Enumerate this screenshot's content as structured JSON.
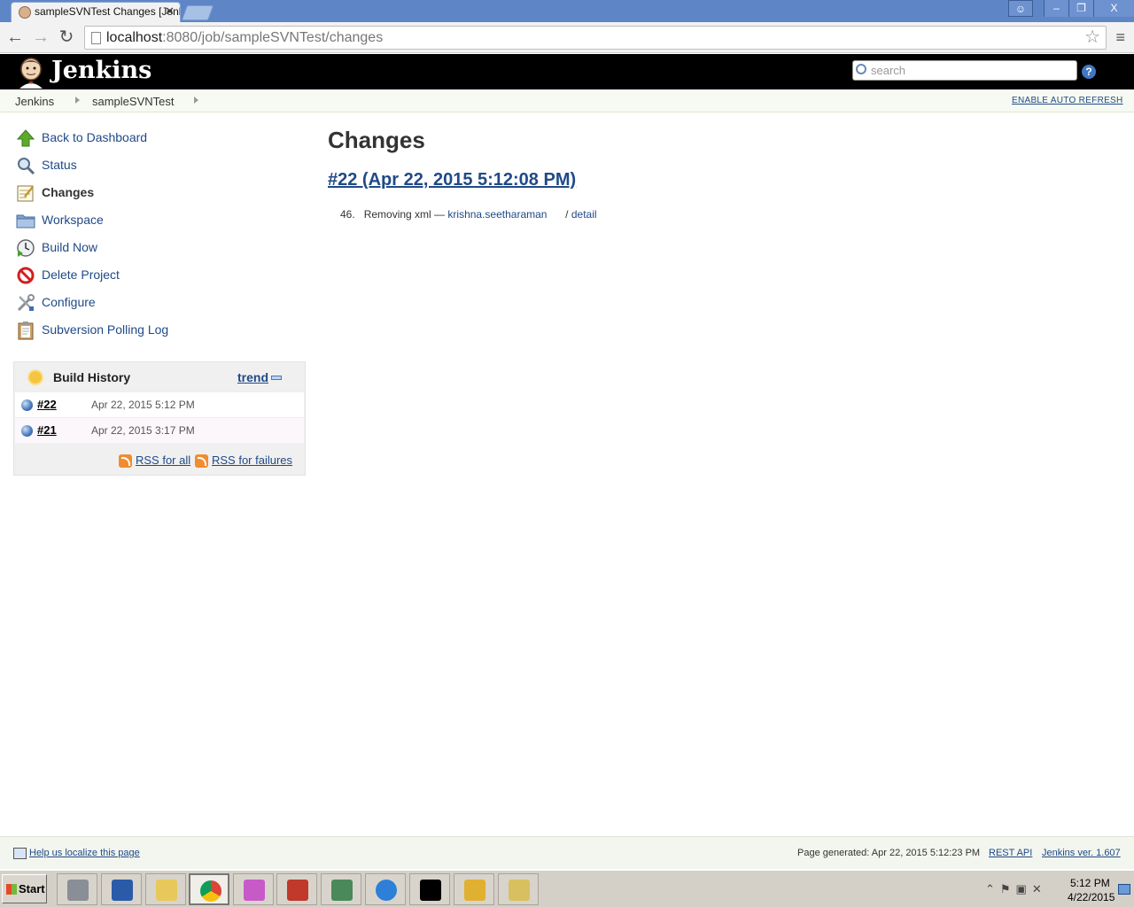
{
  "browser": {
    "tab_title": "sampleSVNTest Changes [Jenkins]",
    "url_host": "localhost",
    "url_rest": ":8080/job/sampleSVNTest/changes"
  },
  "header": {
    "app_name": "Jenkins",
    "search_placeholder": "search",
    "help_label": "?"
  },
  "breadcrumb": {
    "items": [
      "Jenkins",
      "sampleSVNTest"
    ],
    "auto_refresh": "ENABLE AUTO REFRESH"
  },
  "sidebar": {
    "tasks": [
      {
        "label": "Back to Dashboard",
        "icon": "up-arrow-icon"
      },
      {
        "label": "Status",
        "icon": "magnifier-icon"
      },
      {
        "label": "Changes",
        "icon": "notepad-icon"
      },
      {
        "label": "Workspace",
        "icon": "folder-icon"
      },
      {
        "label": "Build Now",
        "icon": "clock-play-icon"
      },
      {
        "label": "Delete Project",
        "icon": "no-entry-icon"
      },
      {
        "label": "Configure",
        "icon": "wrench-screwdriver-icon"
      },
      {
        "label": "Subversion Polling Log",
        "icon": "clipboard-icon"
      }
    ],
    "build_history": {
      "title": "Build History",
      "trend": "trend",
      "builds": [
        {
          "number": "#22",
          "date": "Apr 22, 2015 5:12 PM"
        },
        {
          "number": "#21",
          "date": "Apr 22, 2015 3:17 PM"
        }
      ],
      "rss_all": "RSS for all",
      "rss_failures": "RSS for failures"
    }
  },
  "main": {
    "title": "Changes",
    "build_link": "#22 (Apr 22, 2015 5:12:08 PM)",
    "change": {
      "index": "46.",
      "message": "Removing xml —",
      "author": "krishna.seetharaman",
      "sep": "/",
      "detail": "detail"
    }
  },
  "footer": {
    "localize": "Help us localize this page",
    "generated": "Page generated: Apr 22, 2015 5:12:23 PM",
    "rest_api": "REST API",
    "version": "Jenkins ver. 1.607"
  },
  "taskbar": {
    "start": "Start",
    "time": "5:12 PM",
    "date": "4/22/2015"
  },
  "colors": {
    "link": "#204A87",
    "header_bg": "#000000",
    "titlebar": "#5E86C7"
  }
}
